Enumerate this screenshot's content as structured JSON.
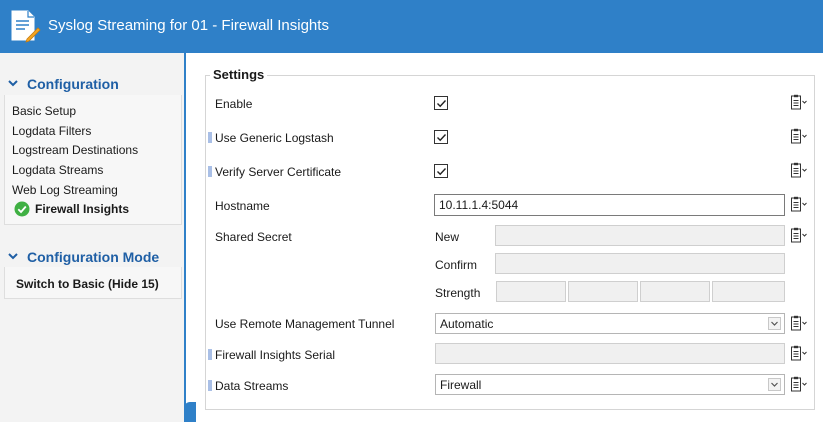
{
  "window": {
    "title": "Syslog Streaming for 01 - Firewall Insights"
  },
  "sidebar": {
    "configuration": {
      "heading": "Configuration",
      "items": [
        {
          "label": "Basic Setup"
        },
        {
          "label": "Logdata Filters"
        },
        {
          "label": "Logstream Destinations"
        },
        {
          "label": "Logdata Streams"
        },
        {
          "label": "Web Log Streaming"
        },
        {
          "label": "Firewall Insights",
          "active": true
        }
      ]
    },
    "mode": {
      "heading": "Configuration Mode",
      "switch_label": "Switch to Basic (Hide 15)"
    }
  },
  "settings": {
    "title": "Settings",
    "enable": {
      "label": "Enable",
      "checked": true
    },
    "generic_logstash": {
      "label": "Use Generic Logstash",
      "checked": true
    },
    "verify_cert": {
      "label": "Verify Server Certificate",
      "checked": true
    },
    "hostname": {
      "label": "Hostname",
      "value": "10.11.1.4:5044"
    },
    "shared_secret": {
      "label": "Shared Secret",
      "new_label": "New",
      "confirm_label": "Confirm",
      "strength_label": "Strength"
    },
    "remote_tunnel": {
      "label": "Use Remote Management Tunnel",
      "value": "Automatic"
    },
    "fi_serial": {
      "label": "Firewall Insights Serial",
      "value": ""
    },
    "data_streams": {
      "label": "Data Streams",
      "value": "Firewall"
    }
  },
  "colors": {
    "accent": "#2f80c8",
    "heading": "#1f5fa5",
    "success": "#3fb043"
  },
  "icons": [
    "document-edit-icon",
    "chevron-icon",
    "check-circle-icon",
    "checkmark-icon",
    "clipboard-icon",
    "dropdown-arrow-icon"
  ]
}
